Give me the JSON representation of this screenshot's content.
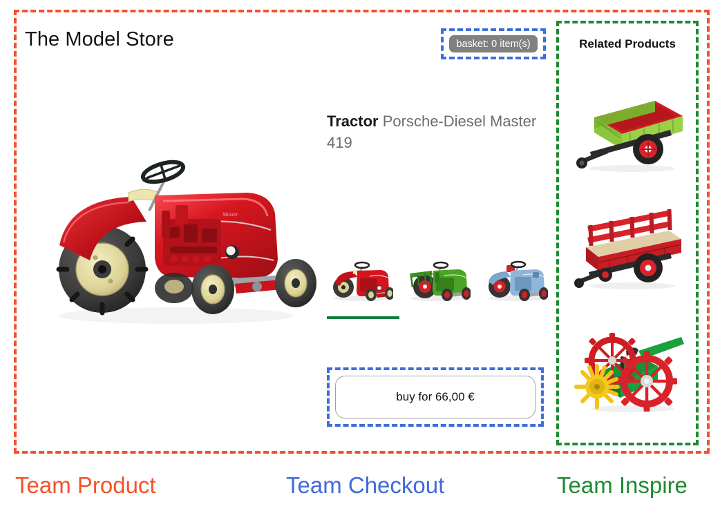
{
  "store": {
    "title": "The Model Store"
  },
  "basket": {
    "label": "basket: 0 item(s)",
    "count": 0
  },
  "product": {
    "category": "Tractor",
    "name": "Porsche-Diesel Master 419",
    "image_alt": "red Porsche-Diesel Master 419 model tractor",
    "buy_label": "buy for 66,00 €",
    "price": "66,00 €",
    "variants": [
      {
        "name": "red-tractor-variant",
        "selected": true
      },
      {
        "name": "green-tractor-variant",
        "selected": false
      },
      {
        "name": "blue-tractor-variant",
        "selected": false
      }
    ]
  },
  "related": {
    "title": "Related Products",
    "items": [
      {
        "name": "green-tipping-trailer"
      },
      {
        "name": "red-stake-trailer"
      },
      {
        "name": "red-green-hay-tedder"
      }
    ]
  },
  "teams": [
    {
      "label": "Team Product",
      "color": "#F4512C"
    },
    {
      "label": "Team Checkout",
      "color": "#4169D8"
    },
    {
      "label": "Team Inspire",
      "color": "#1E8B30"
    }
  ],
  "colors": {
    "team_product": "#F4512C",
    "team_checkout": "#4169D8",
    "team_inspire": "#1E8B30",
    "basket_pill_bg": "#808080",
    "variant_underline": "#0E7D3C"
  }
}
